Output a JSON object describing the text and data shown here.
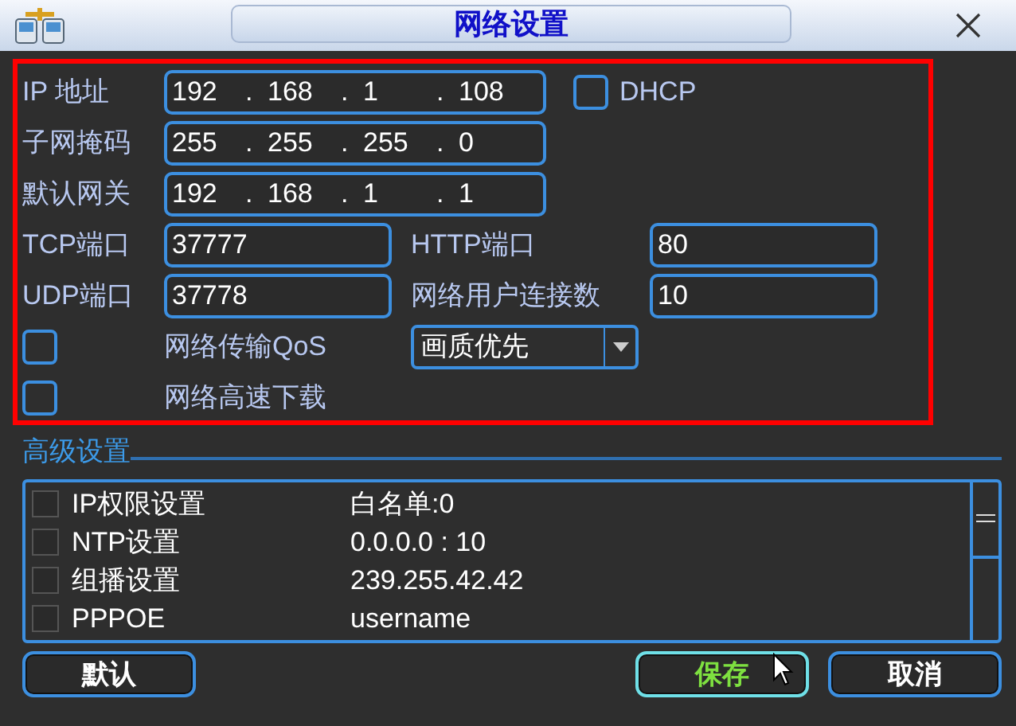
{
  "window": {
    "title": "网络设置"
  },
  "network": {
    "ip": {
      "label": "IP 地址",
      "octets": [
        "192",
        "168",
        "1",
        "108"
      ],
      "separator": "."
    },
    "dhcp": {
      "label": "DHCP",
      "checked": false
    },
    "subnet": {
      "label": "子网掩码",
      "octets": [
        "255",
        "255",
        "255",
        "0"
      ],
      "separator": "."
    },
    "gateway": {
      "label": "默认网关",
      "octets": [
        "192",
        "168",
        "1",
        "1"
      ],
      "separator": "."
    },
    "tcp_port": {
      "label": "TCP端口",
      "value": "37777"
    },
    "http_port": {
      "label": "HTTP端口",
      "value": "80"
    },
    "udp_port": {
      "label": "UDP端口",
      "value": "37778"
    },
    "max_connections": {
      "label": "网络用户连接数",
      "value": "10"
    },
    "qos": {
      "checked": false,
      "label": "网络传输QoS",
      "value": "画质优先"
    },
    "high_speed_download": {
      "checked": false,
      "label": "网络高速下载"
    }
  },
  "advanced": {
    "title": "高级设置",
    "rows": [
      {
        "checked": false,
        "name": "IP权限设置",
        "value": "白名单:0"
      },
      {
        "checked": false,
        "name": "NTP设置",
        "value": "0.0.0.0 : 10"
      },
      {
        "checked": false,
        "name": "组播设置",
        "value": "239.255.42.42"
      },
      {
        "checked": false,
        "name": "PPPOE",
        "value": "username"
      }
    ]
  },
  "buttons": [
    {
      "label": "默认",
      "focused": false
    },
    {
      "label": "保存",
      "focused": true
    },
    {
      "label": "取消",
      "focused": false
    }
  ]
}
